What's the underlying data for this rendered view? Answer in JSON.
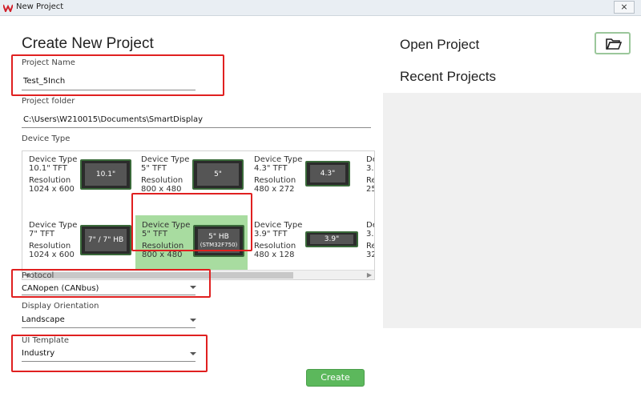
{
  "window": {
    "title": "New Project",
    "close_glyph": "⨯"
  },
  "create": {
    "heading": "Create New Project",
    "project_name": {
      "label": "Project Name",
      "value": "Test_5Inch"
    },
    "project_folder": {
      "label": "Project folder",
      "value": "C:\\Users\\W210015\\Documents\\SmartDisplay"
    },
    "device_type_label": "Device Type",
    "devices": [
      {
        "type_label": "Device Type",
        "type": "10.1\" TFT",
        "res_label": "Resolution",
        "res": "1024 x 600",
        "thumb": "10.1\""
      },
      {
        "type_label": "Device Type",
        "type": "5\" TFT",
        "res_label": "Resolution",
        "res": "800 x 480",
        "thumb": "5\""
      },
      {
        "type_label": "Device Type",
        "type": "4.3\" TFT",
        "res_label": "Resolution",
        "res": "480 x 272",
        "thumb": "4.3\""
      },
      {
        "type_label": "Devi",
        "type": "3.",
        "res_label": "Resol",
        "res": "25"
      },
      {
        "type_label": "Device Type",
        "type": "7\" TFT",
        "res_label": "Resolution",
        "res": "1024 x 600",
        "thumb": "7\" / 7\" HB"
      },
      {
        "type_label": "Device Type",
        "type": "5\" TFT",
        "res_label": "Resolution",
        "res": "800 x 480",
        "thumb": "5\" HB",
        "thumb_sub": "(STM32F750)",
        "selected": true
      },
      {
        "type_label": "Device Type",
        "type": "3.9\" TFT",
        "res_label": "Resolution",
        "res": "480 x 128",
        "thumb": "3.9\""
      },
      {
        "type_label": "Devi",
        "type": "3.",
        "res_label": "Resol",
        "res": "32"
      }
    ],
    "protocol": {
      "label": "Protocol",
      "value": "CANopen (CANbus)"
    },
    "orientation": {
      "label": "Display Orientation",
      "value": "Landscape"
    },
    "ui_template": {
      "label": "UI Template",
      "value": "Industry"
    },
    "create_button": "Create"
  },
  "open": {
    "heading": "Open Project",
    "recent_heading": "Recent Projects",
    "open_icon": "folder-open-icon"
  },
  "colors": {
    "accent_green": "#5cb85c",
    "selected_bg": "#a8dca0",
    "highlight_red": "#e02020"
  }
}
